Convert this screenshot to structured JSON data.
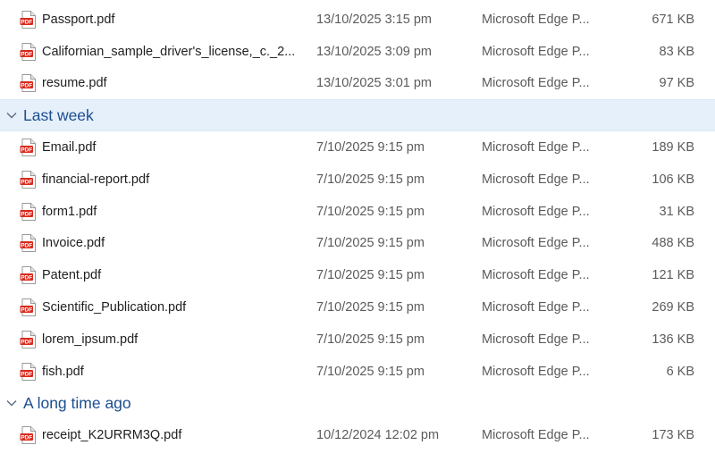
{
  "colors": {
    "group_text": "#1c4d8f",
    "pdf_red": "#d9291c",
    "selected_bg": "#e5f0fb"
  },
  "groups": [
    {
      "label": "",
      "files": [
        {
          "name": "Passport.pdf",
          "date": "13/10/2025 3:15 pm",
          "type": "Microsoft Edge P...",
          "size": "671 KB",
          "icon": "pdf-icon"
        },
        {
          "name": "Californian_sample_driver's_license,_c._2...",
          "date": "13/10/2025 3:09 pm",
          "type": "Microsoft Edge P...",
          "size": "83 KB",
          "icon": "pdf-icon"
        },
        {
          "name": "resume.pdf",
          "date": "13/10/2025 3:01 pm",
          "type": "Microsoft Edge P...",
          "size": "97 KB",
          "icon": "pdf-icon"
        }
      ]
    },
    {
      "label": "Last week",
      "icon": "chevron-down-icon",
      "files": [
        {
          "name": "Email.pdf",
          "date": "7/10/2025 9:15 pm",
          "type": "Microsoft Edge P...",
          "size": "189 KB",
          "icon": "pdf-icon"
        },
        {
          "name": "financial-report.pdf",
          "date": "7/10/2025 9:15 pm",
          "type": "Microsoft Edge P...",
          "size": "106 KB",
          "icon": "pdf-icon"
        },
        {
          "name": "form1.pdf",
          "date": "7/10/2025 9:15 pm",
          "type": "Microsoft Edge P...",
          "size": "31 KB",
          "icon": "pdf-icon"
        },
        {
          "name": "Invoice.pdf",
          "date": "7/10/2025 9:15 pm",
          "type": "Microsoft Edge P...",
          "size": "488 KB",
          "icon": "pdf-icon"
        },
        {
          "name": "Patent.pdf",
          "date": "7/10/2025 9:15 pm",
          "type": "Microsoft Edge P...",
          "size": "121 KB",
          "icon": "pdf-icon"
        },
        {
          "name": "Scientific_Publication.pdf",
          "date": "7/10/2025 9:15 pm",
          "type": "Microsoft Edge P...",
          "size": "269 KB",
          "icon": "pdf-icon"
        },
        {
          "name": "lorem_ipsum.pdf",
          "date": "7/10/2025 9:15 pm",
          "type": "Microsoft Edge P...",
          "size": "136 KB",
          "icon": "pdf-icon"
        },
        {
          "name": "fish.pdf",
          "date": "7/10/2025 9:15 pm",
          "type": "Microsoft Edge P...",
          "size": "6 KB",
          "icon": "pdf-icon"
        }
      ]
    },
    {
      "label": "A long time ago",
      "icon": "chevron-down-icon",
      "files": [
        {
          "name": "receipt_K2URRM3Q.pdf",
          "date": "10/12/2024 12:02 pm",
          "type": "Microsoft Edge P...",
          "size": "173 KB",
          "icon": "pdf-icon"
        }
      ]
    }
  ]
}
